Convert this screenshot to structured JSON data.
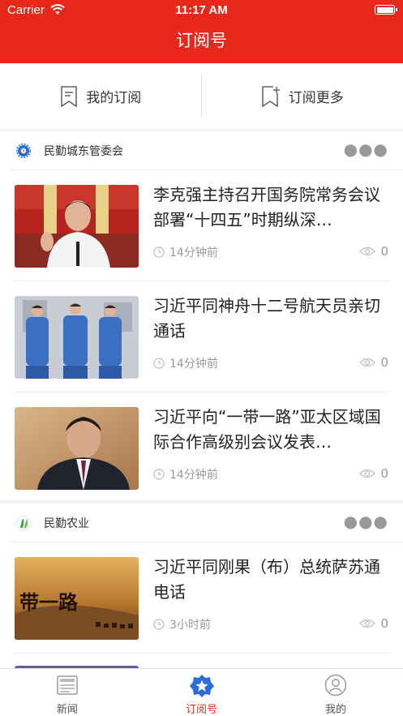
{
  "status": {
    "carrier": "Carrier",
    "time": "11:17 AM"
  },
  "nav": {
    "title": "订阅号"
  },
  "subscribe": {
    "mine": "我的订阅",
    "more": "订阅更多"
  },
  "sections": [
    {
      "name": "民勤城东管委会",
      "items": [
        {
          "title": "李克强主持召开国务院常务会议 部署“十四五”时期纵深…",
          "time": "14分钟前",
          "views": "0"
        },
        {
          "title": "习近平同神舟十二号航天员亲切通话",
          "time": "14分钟前",
          "views": "0"
        },
        {
          "title": "习近平向“一带一路”亚太区域国际合作高级别会议发表…",
          "time": "14分钟前",
          "views": "0"
        }
      ]
    },
    {
      "name": "民勤农业",
      "items": [
        {
          "title": "习近平同刚果（布）总统萨苏通电话",
          "time": "3小时前",
          "views": "0"
        }
      ]
    }
  ],
  "thumbs": {
    "banner_text": "带一路"
  },
  "tabs": [
    {
      "label": "新闻"
    },
    {
      "label": "订阅号"
    },
    {
      "label": "我的"
    }
  ],
  "colors": {
    "brand": "#e8281b"
  }
}
